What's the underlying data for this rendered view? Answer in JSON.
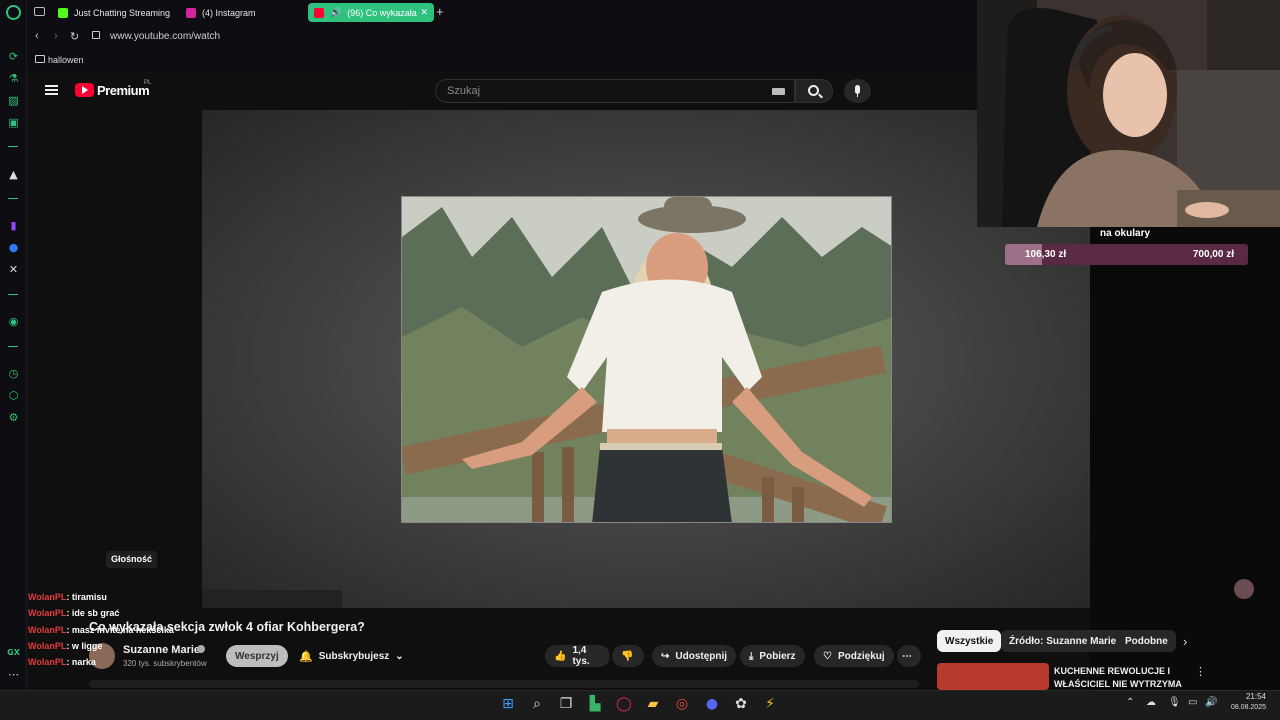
{
  "browser": {
    "tabs": [
      {
        "label": "Just Chatting Streaming",
        "color": "#53fc18"
      },
      {
        "label": "(4) Instagram",
        "color": "#d6249f"
      },
      {
        "label": "(96) Co wykazała",
        "color": "#ff0033"
      }
    ],
    "new_tab": "+",
    "close_tab": "✕",
    "url": "www.youtube.com/watch",
    "bookmark": "hallowen"
  },
  "youtube": {
    "logo_text": "Premium",
    "logo_badge": "PL",
    "search_placeholder": "Szukaj",
    "video_title": "Co wykazała sekcja zwłok 4 ofiar Kohbergera?",
    "channel_name": "Suzanne Marie",
    "subscribers": "320 tys. subskrybentów",
    "support_button": "Wesprzyj",
    "subscribe_button": "Subskrybujesz",
    "likes": "1,4 tys.",
    "share": "Udostępnij",
    "download": "Pobierz",
    "thanks": "Podziękuj",
    "more": "⋯",
    "volume_tooltip": "Głośność",
    "chips": [
      "Wszystkie",
      "Źródło: Suzanne Marie",
      "Podobne"
    ],
    "rec_title_line1": "KUCHENNE REWOLUCJE I",
    "rec_title_line2": "WŁAŚCICIEL NIE WYTRZYMA"
  },
  "stream": {
    "goal_title": "na okulary",
    "goal_current": "106,30 zł",
    "goal_target": "700,00 zł",
    "goal_progress": 0.152
  },
  "chat": [
    {
      "user": "WolanPL",
      "msg": ": tiramisu"
    },
    {
      "user": "WolanPL",
      "msg": ": ide sb grać"
    },
    {
      "user": "WolanPL",
      "msg": ": masz invite na nekscika"
    },
    {
      "user": "WolanPL",
      "msg": ": w ligge"
    },
    {
      "user": "WolanPL",
      "msg": ": narka"
    }
  ],
  "sidebar_label": "GX",
  "clock": {
    "time": "21:54",
    "date": "08.08.2025"
  }
}
